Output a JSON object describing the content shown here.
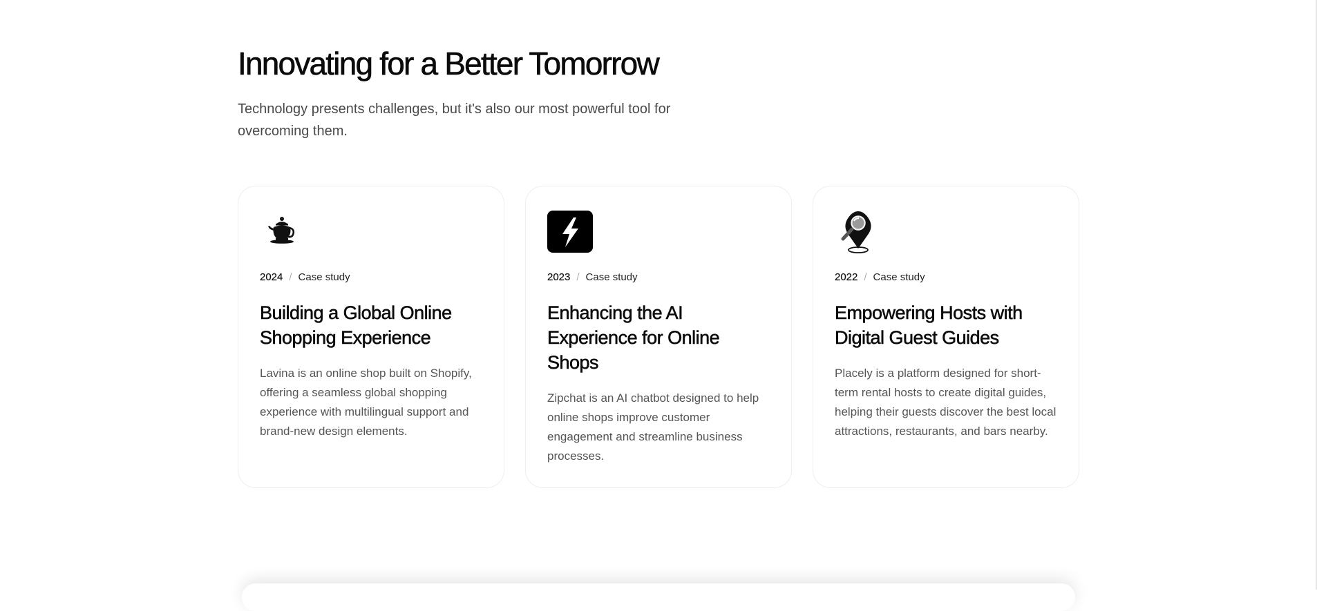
{
  "header": {
    "title": "Innovating for a Better Tomorrow",
    "subtitle": "Technology presents challenges, but it's also our most powerful tool for overcoming them."
  },
  "cards": [
    {
      "icon": "teapot-icon",
      "year": "2024",
      "separator": "/",
      "type": "Case study",
      "title": "Building a Global Online Shopping Experience",
      "description": "Lavina is an online shop built on Shopify, offering a seamless global shopping experience with multilingual support and brand-new design elements."
    },
    {
      "icon": "lightning-bolt-icon",
      "year": "2023",
      "separator": "/",
      "type": "Case study",
      "title": "Enhancing the AI Experience for Online Shops",
      "description": "Zipchat is an AI chatbot designed to help online shops improve customer engagement and streamline business processes."
    },
    {
      "icon": "map-pin-magnifier-icon",
      "year": "2022",
      "separator": "/",
      "type": "Case study",
      "title": "Empowering Hosts with Digital Guest Guides",
      "description": "Placely is a platform designed for short-term rental hosts to create digital guides, helping their guests discover the best local attractions, restaurants, and bars nearby."
    }
  ],
  "colors": {
    "text": "#0b0b0b",
    "muted": "#555555",
    "border": "#eeeeee",
    "background": "#ffffff"
  }
}
